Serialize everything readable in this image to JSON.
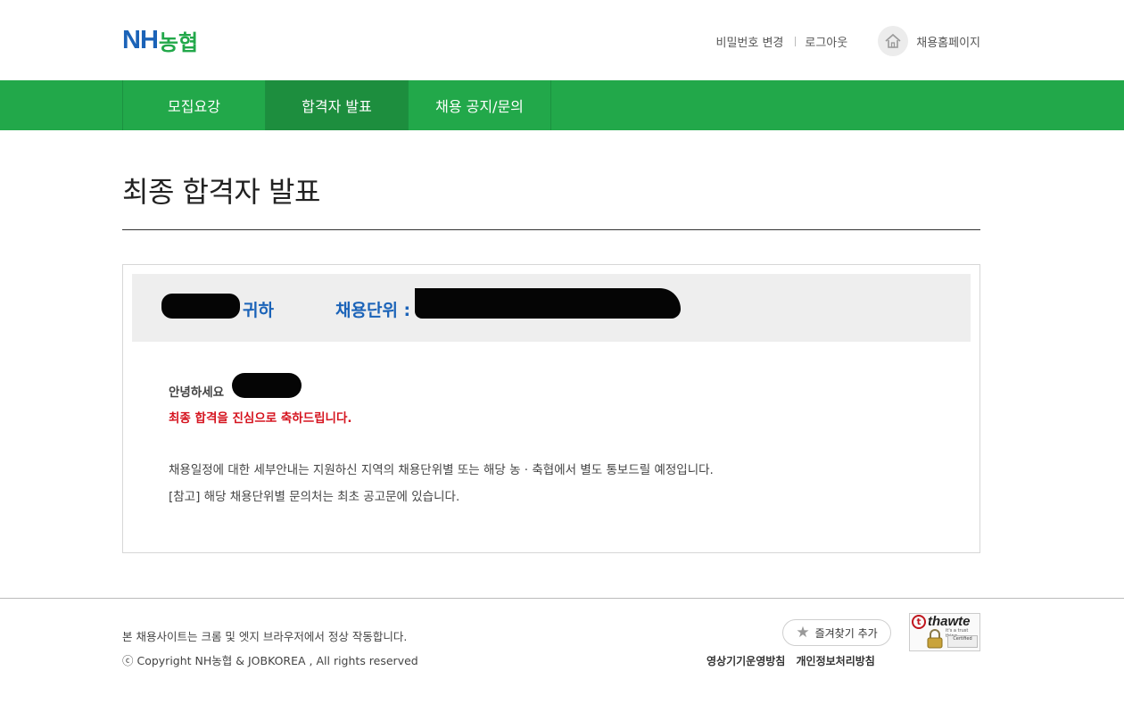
{
  "brand": {
    "logo_latin": "NH",
    "logo_korean": "농협",
    "primary_color": "#1b63b8",
    "green_color": "#22a84a"
  },
  "utility": {
    "change_password": "비밀번호 변경",
    "logout": "로그아웃",
    "home": "채용홈페이지"
  },
  "nav": {
    "items": [
      {
        "label": "모집요강",
        "active": false
      },
      {
        "label": "합격자 발표",
        "active": true
      },
      {
        "label": "채용 공지/문의",
        "active": false
      }
    ]
  },
  "page": {
    "title": "최종 합격자 발표"
  },
  "result": {
    "name_suffix": "귀하",
    "unit_label": "채용단위 :",
    "greeting": "안녕하세요",
    "congrats": "최종 합격을 진심으로 축하드립니다.",
    "notice_1": "채용일정에 대한 세부안내는 지원하신 지역의 채용단위별 또는 해당 농 · 축협에서 별도 통보드릴 예정입니다.",
    "notice_2": "[참고] 해당 채용단위별 문의처는 최초 공고문에 있습니다."
  },
  "footer": {
    "browser_note": "본 채용사이트는 크롬 및 엣지 브라우저에서 정상 작동합니다.",
    "copyright": "ⓒ Copyright NH농협 & JOBKOREA , All rights reserved",
    "favorite_button": "즐겨찾기 추가",
    "link_cctv": "영상기기운영방침",
    "link_privacy": "개인정보처리방침",
    "seal_brand": "thawte",
    "seal_tagline": "it's a trust thing",
    "seal_cert": "Certified"
  }
}
